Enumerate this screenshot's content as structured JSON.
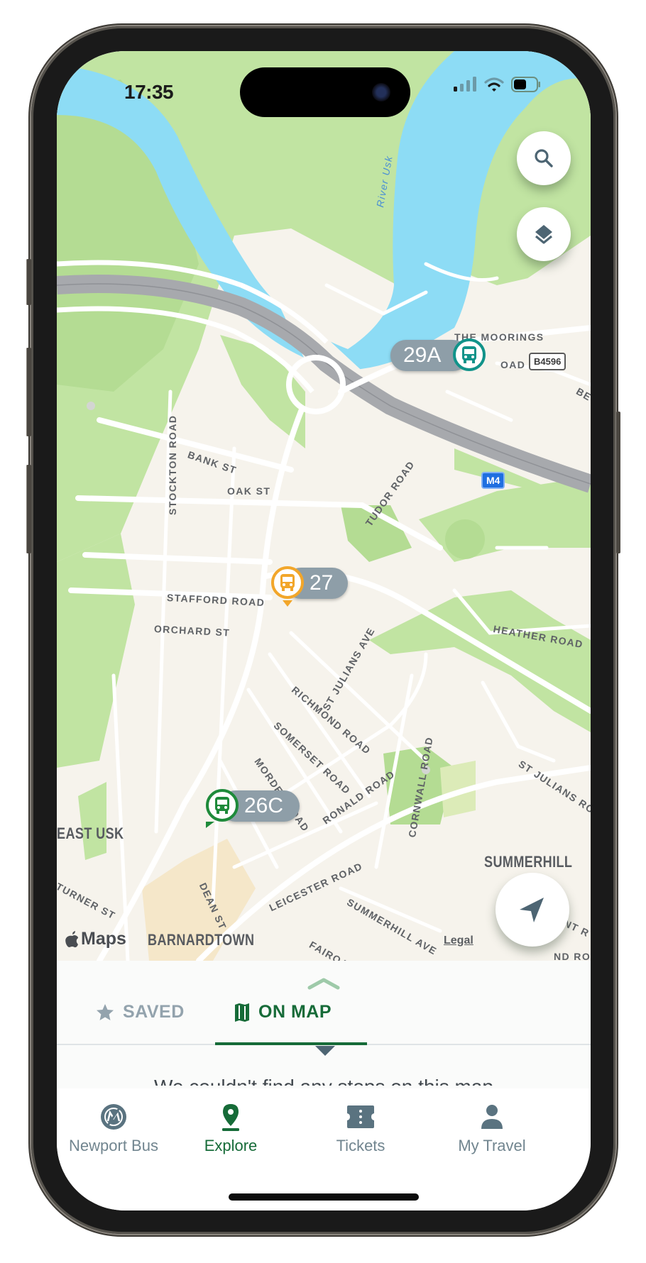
{
  "status_bar": {
    "time": "17:35"
  },
  "map": {
    "provider_label": "Maps",
    "legal_link": "Legal",
    "water_label": "River Usk",
    "road_shields": {
      "motorway": "M4",
      "b_road": "B4596"
    },
    "districts": [
      "EAST USK",
      "BARNARDTOWN",
      "SUMMERHILL"
    ],
    "street_labels": [
      "THE MOORINGS",
      "OAD",
      "BANK ST",
      "STOCKTON ROAD",
      "OAK ST",
      "TUDOR ROAD",
      "STAFFORD ROAD",
      "ORCHARD ST",
      "ST JULIANS AVE",
      "HEATHER ROAD",
      "RICHMOND ROAD",
      "SOMERSET ROAD",
      "MORDEN ROAD",
      "RONALD ROAD",
      "CORNWALL ROAD",
      "ST JULIANS ROA",
      "DEAN ST",
      "LEICESTER ROAD",
      "SUMMERHILL AVE",
      "FAIROAK A",
      "TURNER ST",
      "NT R",
      "ND RO",
      "BE"
    ],
    "buses": [
      {
        "route": "29A",
        "color": "#11938a"
      },
      {
        "route": "27",
        "color": "#f2a62a"
      },
      {
        "route": "26C",
        "color": "#1e8a3a"
      }
    ],
    "buttons": {
      "search": "search-icon",
      "layers": "layers-icon",
      "locate": "location-arrow-icon"
    }
  },
  "sheet": {
    "tabs": [
      {
        "label": "SAVED",
        "icon": "star-icon",
        "active": false
      },
      {
        "label": "ON MAP",
        "icon": "map-icon",
        "active": true
      }
    ],
    "peek_text": "We couldn't find any stops on this map"
  },
  "bottom_nav": {
    "items": [
      {
        "label": "Newport Bus",
        "icon": "newport-bus-logo-icon",
        "active": false
      },
      {
        "label": "Explore",
        "icon": "map-pin-icon",
        "active": true
      },
      {
        "label": "Tickets",
        "icon": "ticket-icon",
        "active": false
      },
      {
        "label": "My Travel",
        "icon": "person-icon",
        "active": false
      }
    ]
  },
  "colors": {
    "brand_green": "#166b38",
    "inactive_gray": "#71858f",
    "pill_gray": "#8e9ea8",
    "water": "#8ddcf5",
    "park": "#c1e4a2"
  }
}
